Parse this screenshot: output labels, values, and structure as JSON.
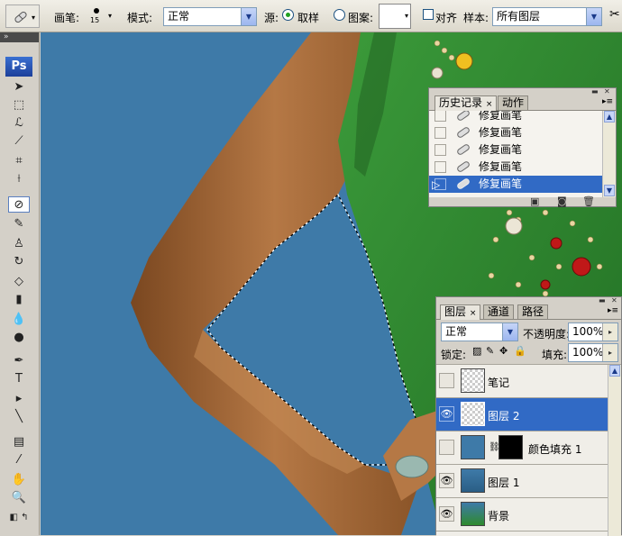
{
  "options_bar": {
    "brush_label": "画笔:",
    "brush_size": "15",
    "mode_label": "模式:",
    "mode_value": "正常",
    "source_label": "源:",
    "sampled_label": "取样",
    "pattern_label": "图案:",
    "aligned_label": "对齐",
    "sample_label": "样本:",
    "sample_value": "所有图层"
  },
  "toolbox": {
    "logo": "Ps",
    "tools": [
      "move-tool",
      "marquee-tool",
      "lasso-tool",
      "magic-wand-tool",
      "crop-tool",
      "slice-tool",
      "healing-brush-tool",
      "brush-tool",
      "stamp-tool",
      "history-brush-tool",
      "eraser-tool",
      "gradient-tool",
      "blur-tool",
      "dodge-tool",
      "pen-tool",
      "type-tool",
      "path-select-tool",
      "line-tool",
      "notes-tool",
      "eyedropper-tool",
      "hand-tool",
      "zoom-tool"
    ]
  },
  "history_panel": {
    "tabs": [
      {
        "label": "历史记录",
        "active": true
      },
      {
        "label": "动作",
        "active": false
      }
    ],
    "items": [
      {
        "label": "修复画笔",
        "selected": false
      },
      {
        "label": "修复画笔",
        "selected": false
      },
      {
        "label": "修复画笔",
        "selected": false
      },
      {
        "label": "修复画笔",
        "selected": false
      },
      {
        "label": "修复画笔",
        "selected": true
      }
    ]
  },
  "layers_panel": {
    "tabs": [
      {
        "label": "图层",
        "active": true
      },
      {
        "label": "通道",
        "active": false
      },
      {
        "label": "路径",
        "active": false
      }
    ],
    "blend_mode": "正常",
    "opacity_label": "不透明度:",
    "opacity_value": "100%",
    "lock_label": "锁定:",
    "fill_label": "填充:",
    "fill_value": "100%",
    "layers": [
      {
        "name": "笔记",
        "visible": false,
        "selected": false
      },
      {
        "name": "图层 2",
        "visible": true,
        "selected": true
      },
      {
        "name": "颜色填充 1",
        "visible": false,
        "selected": false
      },
      {
        "name": "图层 1",
        "visible": true,
        "selected": false
      },
      {
        "name": "背景",
        "visible": true,
        "selected": false
      }
    ]
  },
  "colors": {
    "canvas_bg": "#3e7aa8",
    "selection": "#316ac5",
    "dress": "#2f8a2e",
    "skin": "#a8683a"
  }
}
